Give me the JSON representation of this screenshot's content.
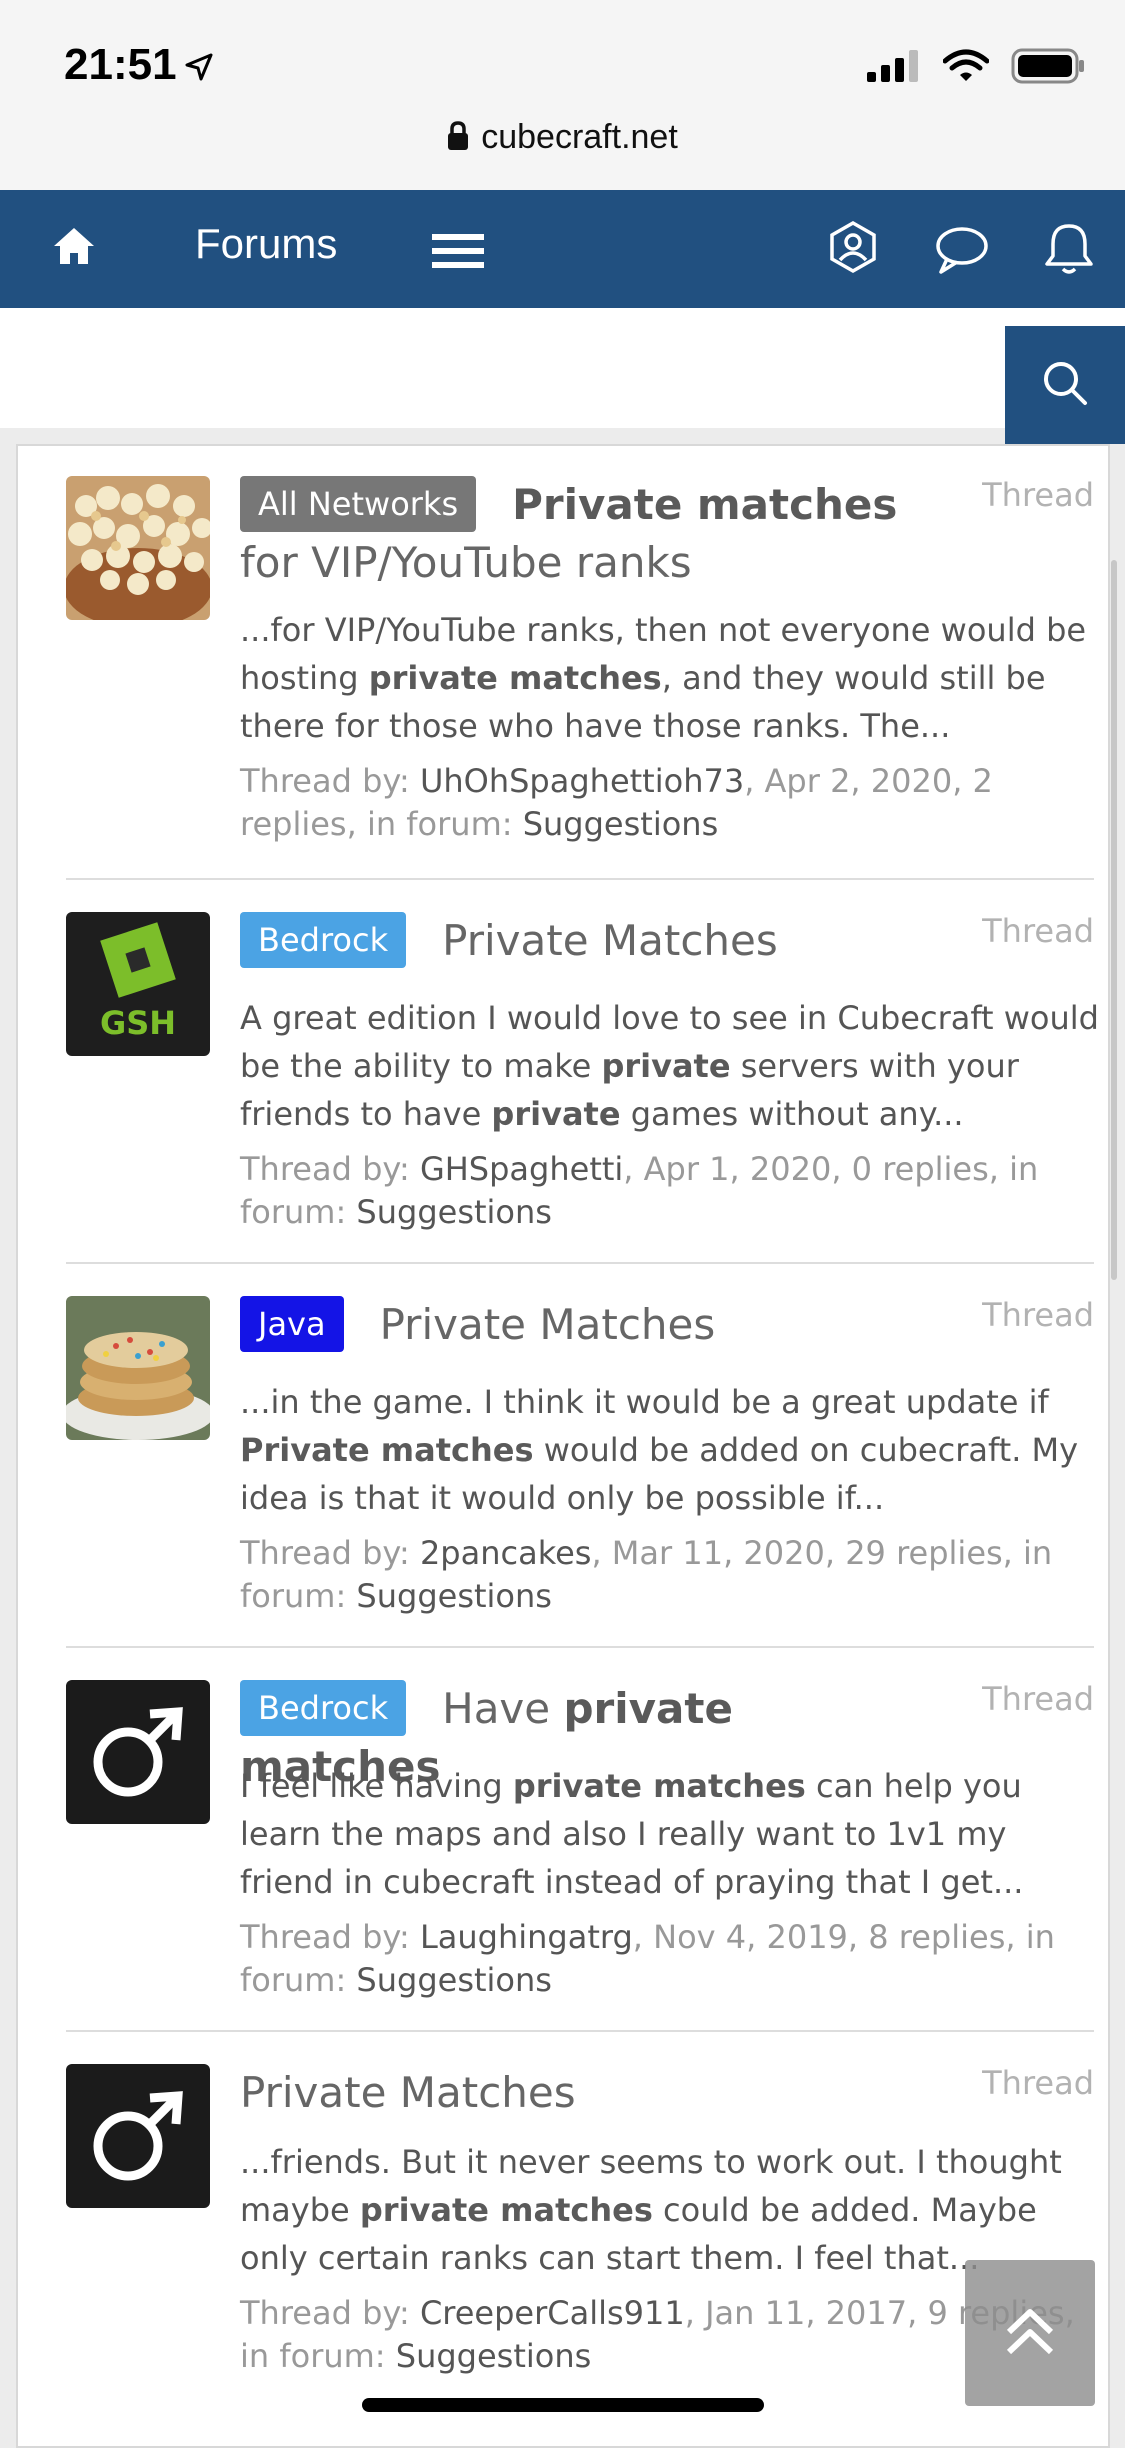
{
  "status_bar": {
    "time": "21:51",
    "url": "cubecraft.net"
  },
  "nav": {
    "forums_label": "Forums"
  },
  "results": [
    {
      "label": "All Networks",
      "label_color": "#777777",
      "title_plain_prefix": "",
      "title_bold": "Private matches",
      "title_plain_suffix": " for VIP/YouTube ranks",
      "type": "Thread",
      "snippet": [
        "...for VIP/YouTube ranks, then not everyone would be hosting ",
        "private matches",
        ", and they would still be there for those who have those ranks. The..."
      ],
      "meta_prefix": "Thread by: ",
      "author": "UhOhSpaghettioh73",
      "meta_details": ", Apr 2, 2020, 2 replies, in forum: ",
      "forum": "Suggestions",
      "avatar": "popcorn-image"
    },
    {
      "label": "Bedrock",
      "label_color": "#4ba3e4",
      "title_plain_prefix": "",
      "title_bold": "",
      "title_plain_suffix": "Private Matches",
      "type": "Thread",
      "snippet": [
        "A great edition I would love to see in Cubecraft would be the ability to make ",
        "private",
        " servers with your friends to have ",
        "private",
        " games without any..."
      ],
      "meta_prefix": "Thread by: ",
      "author": "GHSpaghetti",
      "meta_details": ", Apr 1, 2020, 0 replies, in forum: ",
      "forum": "Suggestions",
      "avatar": "gsh-logo",
      "avatar_text": "GSH"
    },
    {
      "label": "Java",
      "label_color": "#1414e6",
      "title_plain_prefix": "",
      "title_bold": "",
      "title_plain_suffix": "Private Matches",
      "type": "Thread",
      "snippet": [
        "...in the game. I think it would be a great update if ",
        "Private matches",
        " would be added on cubecraft. My idea is that it would only be possible if..."
      ],
      "meta_prefix": "Thread by: ",
      "author": "2pancakes",
      "meta_details": ", Mar 11, 2020, 29 replies, in forum: ",
      "forum": "Suggestions",
      "avatar": "pancakes-image"
    },
    {
      "label": "Bedrock",
      "label_color": "#4ba3e4",
      "title_plain_prefix": "Have ",
      "title_bold": "private matches",
      "title_plain_suffix": "",
      "type": "Thread",
      "snippet": [
        "I feel like having ",
        "private matches",
        " can help you learn the maps and also I really want to 1v1 my friend in cubecraft instead of praying that I get..."
      ],
      "meta_prefix": "Thread by: ",
      "author": "Laughingatrg",
      "meta_details": ", Nov 4, 2019, 8 replies, in forum: ",
      "forum": "Suggestions",
      "avatar": "male-symbol-avatar"
    },
    {
      "label": "",
      "label_color": "",
      "title_plain_prefix": "",
      "title_bold": "",
      "title_plain_suffix": "Private Matches",
      "type": "Thread",
      "snippet": [
        "...friends. But it never seems to work out. I thought maybe ",
        "private matches",
        " could be added. Maybe only certain ranks can start them. I feel that..."
      ],
      "meta_prefix": "Thread by: ",
      "author": "CreeperCalls911",
      "meta_details": ", Jan 11, 2017, 9 replies, in forum: ",
      "forum": "Suggestions",
      "avatar": "male-symbol-avatar"
    }
  ]
}
